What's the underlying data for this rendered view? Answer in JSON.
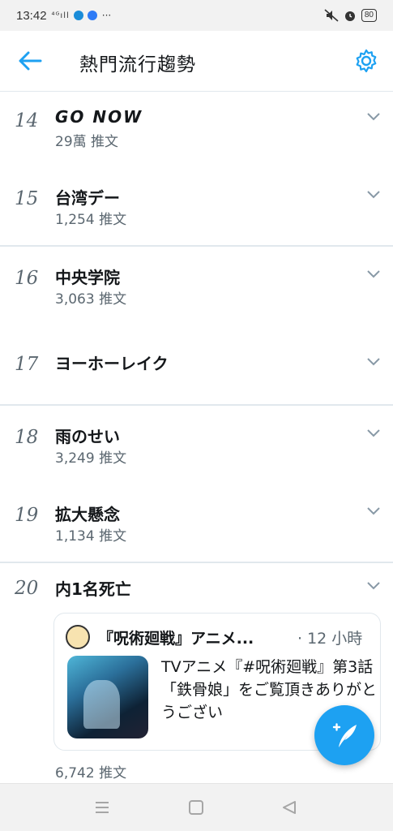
{
  "status_bar": {
    "time": "13:42",
    "signal": "⁴ᴳıll",
    "more": "···",
    "battery": "80"
  },
  "app_bar": {
    "title": "熱門流行趨勢",
    "accent_color": "#1da1f2"
  },
  "trends": [
    {
      "rank": "14",
      "name": "GO NOW",
      "count": "29萬 推文"
    },
    {
      "rank": "15",
      "name": "台湾デー",
      "count": "1,254 推文"
    },
    {
      "rank": "16",
      "name": "中央学院",
      "count": "3,063 推文"
    },
    {
      "rank": "17",
      "name": "ヨーホーレイク",
      "count": ""
    },
    {
      "rank": "18",
      "name": "雨のせい",
      "count": "3,249 推文"
    },
    {
      "rank": "19",
      "name": "拡大懸念",
      "count": "1,134 推文"
    },
    {
      "rank": "20",
      "name": "内1名死亡",
      "count": "6,742 推文"
    }
  ],
  "tweet_card": {
    "author": "『呪術廻戦』アニメ...",
    "time": "· 12 小時",
    "text": "TVアニメ『#呪術廻戦』第3話「鉄骨娘」をご覧頂きありがとうござい"
  },
  "icons": {
    "back": "arrow-left-icon",
    "settings": "gear-icon",
    "expand": "chevron-down-icon",
    "compose": "compose-tweet-icon",
    "nav_menu": "menu-icon",
    "nav_home": "square-icon",
    "nav_back": "triangle-back-icon"
  }
}
